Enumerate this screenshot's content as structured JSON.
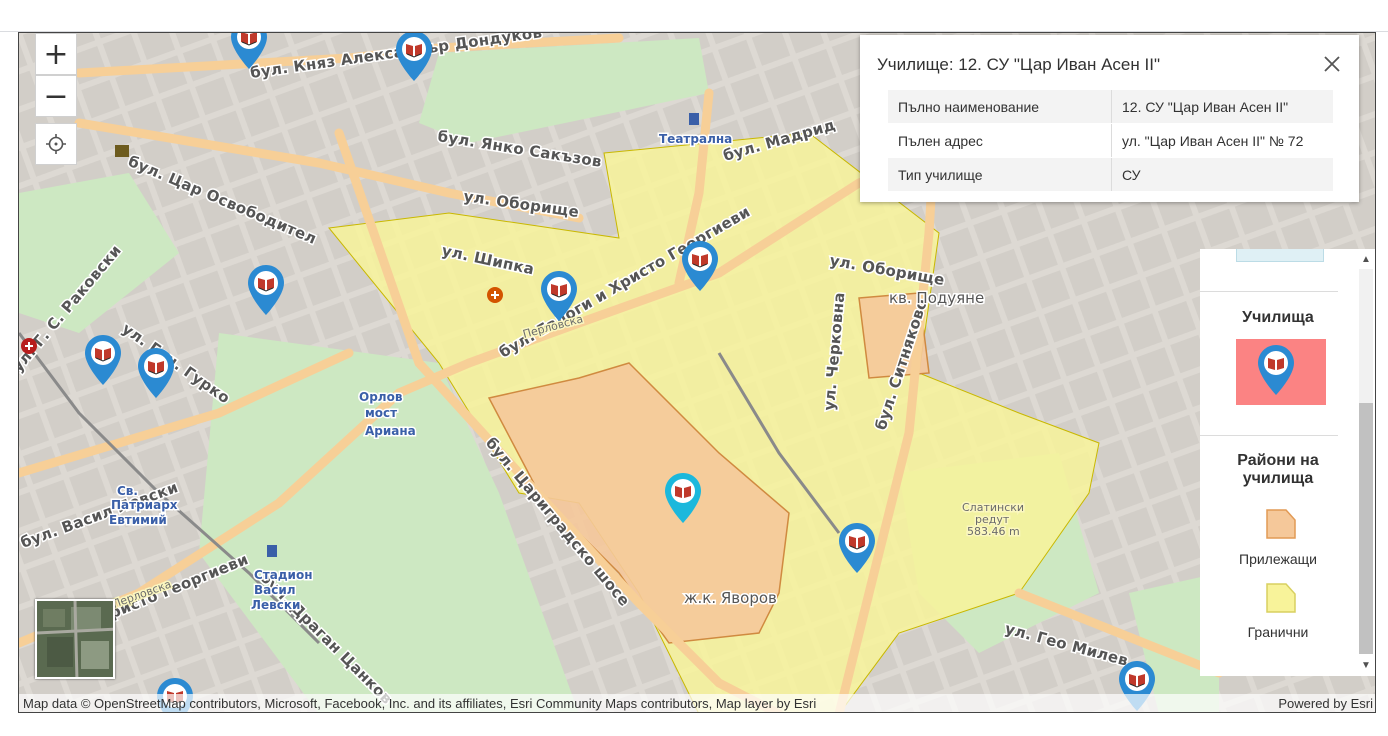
{
  "map": {
    "zoom_in_label": "+",
    "zoom_out_label": "−",
    "street_labels": {
      "knyaz": "бул. Княз Александър Дондуков",
      "yanko": "бул. Янко Сакъзов",
      "madrid": "бул. Мадрид",
      "tsar_osv": "бул. Цар Освободител",
      "oborishte1": "ул. Оборище",
      "oborishte2": "ул. Оборище",
      "shipka": "ул. Шипка",
      "evlogi": "бул. Евлоги и Христо Георгиеви",
      "rakovski": "ул. Г. С. Раковски",
      "gurko": "ул. Ген. Гурко",
      "tsarigradsko": "бул. Цариградско шосе",
      "cherkovna": "ул. Черковна",
      "sitnyakovo": "бул. Ситняково",
      "vasil": "бул. Васил Левски",
      "georgievi2": "Христо Георгиеви",
      "tsankov": "бул. Драган Цанков",
      "geo": "ул. Гео Милев",
      "perlovska1": "Перловска",
      "perlovska2": "Перловска"
    },
    "place_labels": {
      "podyane": "кв. Подуяне",
      "yavorov": "ж.к. Яворов",
      "orlov_1": "Орлов",
      "orlov_2": "мост",
      "ariana": "Ариана",
      "teatralna": "Театрална",
      "patriarh_1": "Св.",
      "patriarh_2": "Патриарх",
      "patriarh_3": "Евтимий",
      "stadion_1": "Стадион",
      "stadion_2": "Васил",
      "stadion_3": "Левски",
      "slatinski_1": "Слатински",
      "slatinski_2": "редут",
      "slatinski_3": "583.46 m"
    },
    "attribution_left": "Map data © OpenStreetMap contributors, Microsoft, Facebook, Inc. and its affiliates, Esri Community Maps contributors, Map layer by Esri",
    "attribution_right": "Powered by Esri"
  },
  "popup": {
    "title": "Училище: 12. СУ \"Цар Иван Асен II\"",
    "rows": [
      {
        "key": "Пълно наименование",
        "value": "12. СУ \"Цар Иван Асен II\""
      },
      {
        "key": "Пълен адрес",
        "value": "ул. \"Цар Иван Асен II\" № 72"
      },
      {
        "key": "Тип училище",
        "value": "СУ"
      }
    ]
  },
  "legend": {
    "schools_title": "Училища",
    "districts_title_1": "Райони на",
    "districts_title_2": "училища",
    "adjacent_label": "Прилежащи",
    "border_label": "Гранични"
  },
  "colors": {
    "pin": "#2b8ad2",
    "pin_selected": "#1cb8dc",
    "adjacent_fill": "#f5c89a",
    "border_fill": "#f8f39a",
    "legend_swatch_bg": "#fb8383",
    "park": "#cde8c2",
    "road_major": "#f7cf97"
  }
}
